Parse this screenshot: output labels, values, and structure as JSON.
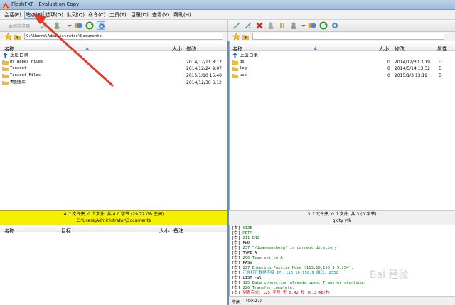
{
  "window": {
    "title": "FlashFXP - Evaluation Copy"
  },
  "menu": [
    {
      "label": "会话(E)",
      "active": false
    },
    {
      "label": "站点(S)",
      "active": true
    },
    {
      "label": "选项(O)",
      "active": false
    },
    {
      "label": "队列(Q)",
      "active": false
    },
    {
      "label": "命令(C)",
      "active": false
    },
    {
      "label": "工具(T)",
      "active": false
    },
    {
      "label": "目录(D)",
      "active": false
    },
    {
      "label": "查看(V)",
      "active": false
    },
    {
      "label": "帮助(H)",
      "active": false
    }
  ],
  "toolbar_left": {
    "local_browser_label": "本地浏览器"
  },
  "left_pane": {
    "path": "C:\\Users\\Administrator\\Documents",
    "columns": {
      "name": "名称",
      "size": "大小",
      "modified": "修改"
    },
    "up_label": "上层目录",
    "rows": [
      {
        "name": "My Webex Files",
        "size": "",
        "modified": "2014/12/11 8:12"
      },
      {
        "name": "Tencent",
        "size": "",
        "modified": "2014/12/24 9:07"
      },
      {
        "name": "Tencent Files",
        "size": "",
        "modified": "2015/1/10 15:40"
      },
      {
        "name": "美图图库",
        "size": "",
        "modified": "2014/12/30 6:12"
      }
    ],
    "status_line1": "4 个文件夹, 0 个文件, 共 4 0 字节 (29.72 GB 空闲)",
    "status_line2": "C:\\Users\\Administrator\\Documents"
  },
  "right_pane": {
    "columns": {
      "name": "名称",
      "size": "大小",
      "modified": "修改",
      "attr": "属性"
    },
    "up_label": "上层目录",
    "rows": [
      {
        "name": "db",
        "size": "0",
        "modified": "2014/12/30 3:19",
        "attr": "D"
      },
      {
        "name": "log",
        "size": "0",
        "modified": "2014/5/14 13:32",
        "attr": "D"
      },
      {
        "name": "web",
        "size": "0",
        "modified": "2015/1/3 13:19",
        "attr": "D"
      }
    ],
    "status_line1": "3 个文件夹, 0 个文件, 共 3 (0 字节)",
    "status_line2": "gkjty yth"
  },
  "queue": {
    "columns": {
      "name": "名称",
      "target": "目标",
      "size": "大小",
      "note": "备注"
    }
  },
  "log": [
    {
      "tag": "[右]",
      "msg": "SIZE",
      "color": "green"
    },
    {
      "tag": "[右]",
      "msg": "MDTM",
      "color": "green"
    },
    {
      "tag": "[右]",
      "msg": "211 END",
      "color": "green"
    },
    {
      "tag": "[右]",
      "msg": "PWD",
      "color": "black"
    },
    {
      "tag": "[右]",
      "msg": "257 \"/duanwenzheng\" is current directory.",
      "color": "green"
    },
    {
      "tag": "[右]",
      "msg": "TYPE A",
      "color": "black"
    },
    {
      "tag": "[右]",
      "msg": "200 Type set to A",
      "color": "green"
    },
    {
      "tag": "[右]",
      "msg": "PASV",
      "color": "black"
    },
    {
      "tag": "[右]",
      "msg": "227 Entering Passive Mode (113,10,156,9,9,254).",
      "color": "green"
    },
    {
      "tag": "[右]",
      "msg": "正在打开数据连接 IP: 113.10.156.9 端口: 2558",
      "color": "cyan"
    },
    {
      "tag": "[右]",
      "msg": "LIST -al",
      "color": "black"
    },
    {
      "tag": "[右]",
      "msg": "125 Data connection already open; Transfer starting.",
      "color": "green"
    },
    {
      "tag": "[右]",
      "msg": "226 Transfer complete.",
      "color": "green"
    },
    {
      "tag": "[右]",
      "msg": "列表完成: 125 字节 于 0.42 秒 (0.3 KB/秒)",
      "color": "red"
    }
  ],
  "bottom_status": {
    "state": "空闲",
    "time": "(00:27)"
  },
  "watermark": "Bai 经验",
  "colors": {
    "status_yellow": "#f5f000",
    "folder": "#e8b84a",
    "arrow": "#e03a2a"
  }
}
